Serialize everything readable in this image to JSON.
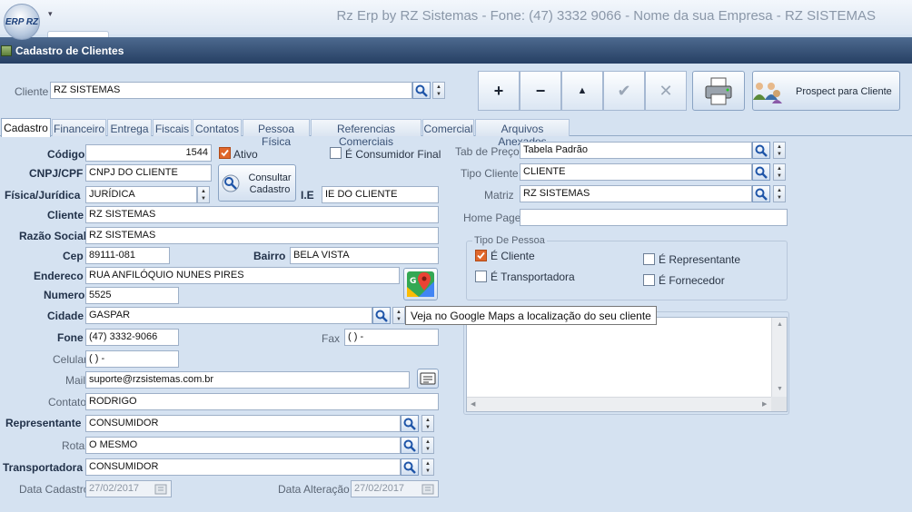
{
  "app": {
    "title": "Rz Erp by RZ Sistemas - Fone: (47) 3332 9066 - Nome da sua Empresa - RZ SISTEMAS",
    "logo_text": "ERP RZ"
  },
  "module": {
    "title": "Cadastro de Clientes"
  },
  "search": {
    "label": "Cliente",
    "value": "RZ SISTEMAS"
  },
  "toolbar": {
    "add": "+",
    "remove": "−",
    "up": "▲",
    "confirm": "✔",
    "cancel": "✕",
    "prospect": "Prospect para Cliente"
  },
  "tabs": [
    "Cadastro",
    "Financeiro",
    "Entrega",
    "Fiscais",
    "Contatos",
    "Pessoa Física",
    "Referencias Comerciais",
    "Comercial",
    "Arquivos Anexados"
  ],
  "form": {
    "codigo": {
      "label": "Código",
      "value": "1544"
    },
    "ativo": {
      "label": "Ativo",
      "checked": true
    },
    "consumidor_final": {
      "label": "É Consumidor Final",
      "checked": false
    },
    "cnpj": {
      "label": "CNPJ/CPF",
      "value": "CNPJ DO CLIENTE"
    },
    "consultar_btn": "Consultar Cadastro",
    "fisica_juridica": {
      "label": "Física/Jurídica",
      "value": "JURÍDICA"
    },
    "ie": {
      "label": "I.E",
      "value": "IE DO CLIENTE"
    },
    "cliente": {
      "label": "Cliente",
      "value": "RZ SISTEMAS"
    },
    "razao_social": {
      "label": "Razão Social",
      "value": "RZ SISTEMAS"
    },
    "cep": {
      "label": "Cep",
      "value": "89111-081"
    },
    "bairro": {
      "label": "Bairro",
      "value": "BELA VISTA"
    },
    "endereco": {
      "label": "Endereco",
      "value": "RUA ANFILÓQUIO NUNES PIRES"
    },
    "numero": {
      "label": "Numero",
      "value": "5525"
    },
    "cidade": {
      "label": "Cidade",
      "value": "GASPAR"
    },
    "fone": {
      "label": "Fone",
      "value": "(47) 3332-9066"
    },
    "fax": {
      "label": "Fax",
      "value": "(  )     -"
    },
    "celular": {
      "label": "Celular",
      "value": "(  )     -"
    },
    "mail": {
      "label": "Mail",
      "value": "suporte@rzsistemas.com.br"
    },
    "contato": {
      "label": "Contato",
      "value": "RODRIGO"
    },
    "representante": {
      "label": "Representante",
      "value": "CONSUMIDOR"
    },
    "rota": {
      "label": "Rota",
      "value": "O MESMO"
    },
    "transportadora": {
      "label": "Transportadora",
      "value": "CONSUMIDOR"
    },
    "data_cadastro": {
      "label": "Data Cadastro",
      "value": "27/02/2017"
    },
    "data_alteracao": {
      "label": "Data Alteração",
      "value": "27/02/2017"
    }
  },
  "right": {
    "tab_preco": {
      "label": "Tab de Preço",
      "value": "Tabela Padrão"
    },
    "tipo_cliente": {
      "label": "Tipo Cliente",
      "value": "CLIENTE"
    },
    "matriz": {
      "label": "Matriz",
      "value": "RZ SISTEMAS"
    },
    "home_page": {
      "label": "Home Page",
      "value": ""
    },
    "tipo_pessoa": {
      "title": "Tipo De Pessoa",
      "e_cliente": {
        "label": "É Cliente",
        "checked": true
      },
      "e_representante": {
        "label": "É Representante",
        "checked": false
      },
      "e_transportadora": {
        "label": "É Transportadora",
        "checked": false
      },
      "e_fornecedor": {
        "label": "É Fornecedor",
        "checked": false
      }
    }
  },
  "tooltip": "Veja no Google Maps a localização do seu cliente",
  "colors": {
    "accent_check": "#e0672c",
    "module_bar": "#2f4a70",
    "background": "#d5e2f1"
  }
}
